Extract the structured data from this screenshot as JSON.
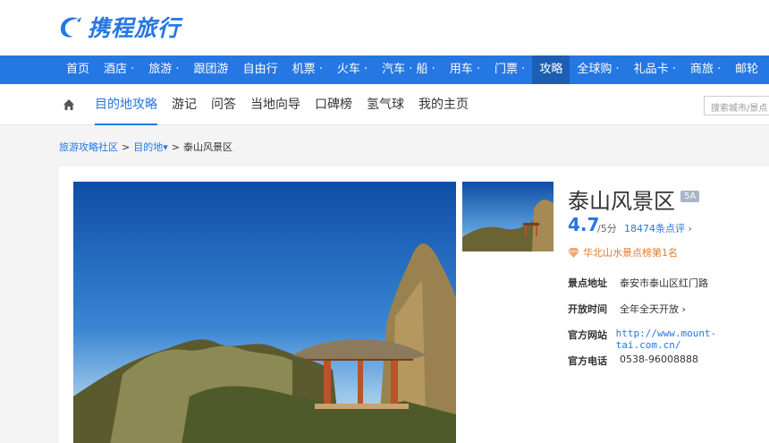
{
  "brand": {
    "logo_text": "携程旅行",
    "accent": "#2577e3"
  },
  "nav": {
    "items": [
      "首页",
      "酒店 ·",
      "旅游 ·",
      "跟团游",
      "自由行",
      "机票 ·",
      "火车 ·",
      "汽车 · 船 ·",
      "用车 ·",
      "门票 ·",
      "攻略",
      "全球购 ·",
      "礼品卡 ·",
      "商旅 ·",
      "邮轮"
    ],
    "active_index": 10
  },
  "subnav": {
    "items": [
      "目的地攻略",
      "游记",
      "问答",
      "当地向导",
      "口碑榜",
      "氢气球",
      "我的主页"
    ],
    "active_index": 0,
    "search_placeholder": "搜索城市/景点"
  },
  "breadcrumb": {
    "root": "旅游攻略社区",
    "mid": "目的地",
    "current": "泰山风景区"
  },
  "attraction": {
    "name": "泰山风景区",
    "level_badge": "5A",
    "score": "4.7",
    "score_unit": "/5分",
    "review_count": "18474条点评 ›",
    "rank": "华北山水景点榜第1名",
    "info": [
      {
        "label": "景点地址",
        "value": "泰安市泰山区红门路"
      },
      {
        "label": "开放时间",
        "value": "全年全天开放 ›"
      },
      {
        "label": "官方网站",
        "value": "http://www.mount-tai.com.cn/"
      },
      {
        "label": "官方电话",
        "value": "0538-96008888"
      }
    ]
  }
}
